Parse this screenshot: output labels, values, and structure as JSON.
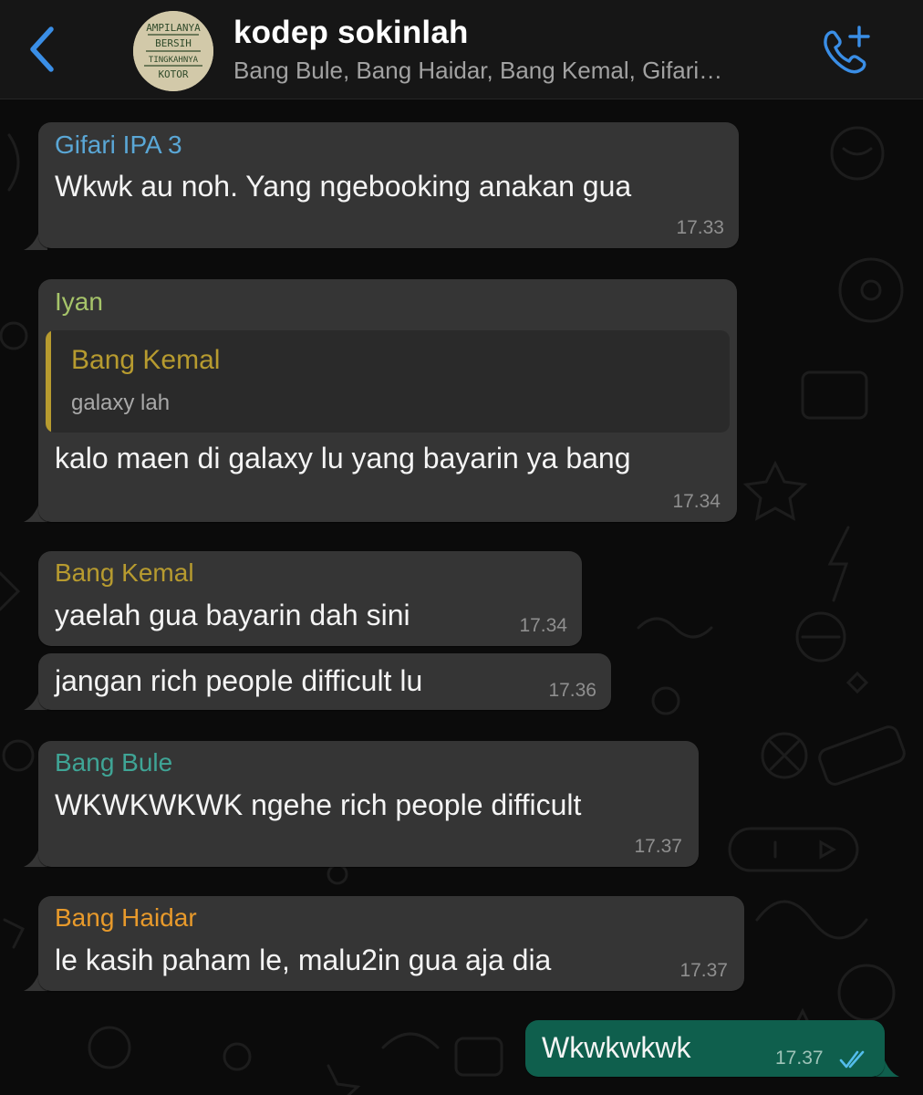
{
  "header": {
    "back_icon": "chevron-left-icon",
    "avatar_text": [
      "AMPILANYA",
      "BERSIH",
      "TINGKAHNYA",
      "KOTOR"
    ],
    "title": "kodep sokinlah",
    "members": "Bang Bule, Bang Haidar, Bang Kemal, Gifari…",
    "call_icon": "add-call-icon"
  },
  "colors": {
    "header_bg": "#161616",
    "bubble_in": "#353535",
    "bubble_out": "#0f5f4d",
    "accent": "#3a8ee6",
    "read_ticks": "#53bdeb"
  },
  "messages": [
    {
      "sender": "Gifari IPA 3",
      "sender_color": "#5aa7d6",
      "text": "Wkwk au noh. Yang ngebooking anakan gua",
      "time": "17.33"
    },
    {
      "sender": "Iyan",
      "sender_color": "#a6c46a",
      "quote_sender": "Bang Kemal",
      "quote_color": "#b79b2f",
      "quote_text": "galaxy lah",
      "text": "kalo maen di galaxy lu yang bayarin ya bang",
      "time": "17.34"
    },
    {
      "sender": "Bang Kemal",
      "sender_color": "#b79b2f",
      "text": "yaelah gua bayarin dah sini",
      "time": "17.34"
    },
    {
      "text": "jangan rich people difficult lu",
      "time": "17.36"
    },
    {
      "sender": "Bang Bule",
      "sender_color": "#3fa596",
      "text": "WKWKWKWK ngehe rich people difficult",
      "time": "17.37"
    },
    {
      "sender": "Bang Haidar",
      "sender_color": "#e89a2b",
      "text": "le kasih paham le, malu2in gua aja dia",
      "time": "17.37"
    },
    {
      "text": "Wkwkwkwk",
      "time": "17.37",
      "status": "read",
      "status_icon": "double-check-icon"
    }
  ]
}
